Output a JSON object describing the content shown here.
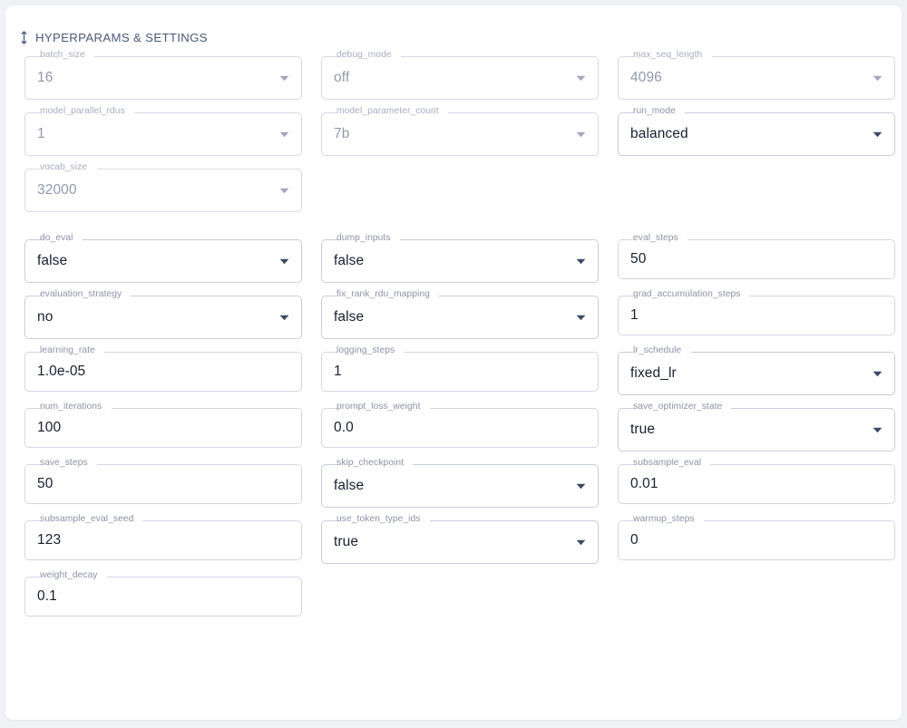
{
  "panel": {
    "title": "HYPERPARAMS & SETTINGS",
    "drag_handle_icon": "drag-move-vertical-icon"
  },
  "colors": {
    "page_background": "#f0f1f5",
    "card_background": "#ffffff",
    "title_text": "#4c5878",
    "field_border": "#c9cdd9",
    "label_text": "#8d93a6",
    "value_text_active": "#17202e",
    "value_text_muted": "#9399ab",
    "caret_active": "#3c4a66",
    "caret_muted": "#a3a8b8"
  },
  "groups": [
    {
      "name": "model-config-group",
      "state": "muted",
      "fields": [
        {
          "name": "batch_size",
          "label": "batch_size",
          "value": "16",
          "control": "select",
          "state": "muted"
        },
        {
          "name": "debug_mode",
          "label": "debug_mode",
          "value": "off",
          "control": "select",
          "state": "muted"
        },
        {
          "name": "max_seq_length",
          "label": "max_seq_length",
          "value": "4096",
          "control": "select",
          "state": "muted"
        },
        {
          "name": "model_parallel_rdus",
          "label": "model_parallel_rdus",
          "value": "1",
          "control": "select",
          "state": "muted"
        },
        {
          "name": "model_parameter_count",
          "label": "model_parameter_count",
          "value": "7b",
          "control": "select",
          "state": "muted"
        },
        {
          "name": "run_mode",
          "label": "run_mode",
          "value": "balanced",
          "control": "select",
          "state": "active"
        },
        {
          "name": "vocab_size",
          "label": "vocab_size",
          "value": "32000",
          "control": "select",
          "state": "muted"
        }
      ]
    },
    {
      "name": "training-settings-group",
      "state": "active",
      "fields": [
        {
          "name": "do_eval",
          "label": "do_eval",
          "value": "false",
          "control": "select",
          "state": "active"
        },
        {
          "name": "dump_inputs",
          "label": "dump_inputs",
          "value": "false",
          "control": "select",
          "state": "active"
        },
        {
          "name": "eval_steps",
          "label": "eval_steps",
          "value": "50",
          "control": "text",
          "state": "active"
        },
        {
          "name": "evaluation_strategy",
          "label": "evaluation_strategy",
          "value": "no",
          "control": "select",
          "state": "active"
        },
        {
          "name": "fix_rank_rdu_mapping",
          "label": "fix_rank_rdu_mapping",
          "value": "false",
          "control": "select",
          "state": "active"
        },
        {
          "name": "grad_accumulation_steps",
          "label": "grad_accumulation_steps",
          "value": "1",
          "control": "text",
          "state": "active"
        },
        {
          "name": "learning_rate",
          "label": "learning_rate",
          "value": "1.0e-05",
          "control": "text",
          "state": "active"
        },
        {
          "name": "logging_steps",
          "label": "logging_steps",
          "value": "1",
          "control": "text",
          "state": "active"
        },
        {
          "name": "lr_schedule",
          "label": "lr_schedule",
          "value": "fixed_lr",
          "control": "select",
          "state": "active"
        },
        {
          "name": "num_iterations",
          "label": "num_iterations",
          "value": "100",
          "control": "text",
          "state": "active"
        },
        {
          "name": "prompt_loss_weight",
          "label": "prompt_loss_weight",
          "value": "0.0",
          "control": "text",
          "state": "active"
        },
        {
          "name": "save_optimizer_state",
          "label": "save_optimizer_state",
          "value": "true",
          "control": "select",
          "state": "active"
        },
        {
          "name": "save_steps",
          "label": "save_steps",
          "value": "50",
          "control": "text",
          "state": "active"
        },
        {
          "name": "skip_checkpoint",
          "label": "skip_checkpoint",
          "value": "false",
          "control": "select",
          "state": "active"
        },
        {
          "name": "subsample_eval",
          "label": "subsample_eval",
          "value": "0.01",
          "control": "text",
          "state": "active"
        },
        {
          "name": "subsample_eval_seed",
          "label": "subsample_eval_seed",
          "value": "123",
          "control": "text",
          "state": "active"
        },
        {
          "name": "use_token_type_ids",
          "label": "use_token_type_ids",
          "value": "true",
          "control": "select",
          "state": "active"
        },
        {
          "name": "warmup_steps",
          "label": "warmup_steps",
          "value": "0",
          "control": "text",
          "state": "active"
        },
        {
          "name": "weight_decay",
          "label": "weight_decay",
          "value": "0.1",
          "control": "text",
          "state": "active"
        }
      ]
    }
  ]
}
